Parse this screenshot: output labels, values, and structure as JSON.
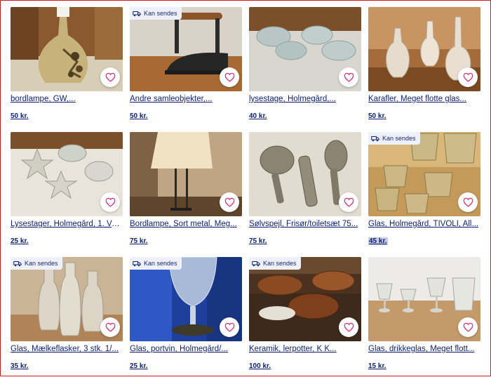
{
  "badge_label": "Kan sendes",
  "colors": {
    "link": "#0b1f7a",
    "heart": "#e0336b",
    "badge_bg": "#eef1fb"
  },
  "listings": [
    {
      "title": "bordlampe, GW,...",
      "price": "50 kr.",
      "ships": false,
      "image": "ceramic-lamp"
    },
    {
      "title": "Andre samleobjekter,...",
      "price": "50 kr.",
      "ships": true,
      "image": "flat-iron"
    },
    {
      "title": "lysestage, Holmegård,...",
      "price": "40 kr.",
      "ships": false,
      "image": "glass-candleholders"
    },
    {
      "title": "Karafler, Meget flotte glas...",
      "price": "50 kr.",
      "ships": false,
      "image": "glass-decanters"
    },
    {
      "title": "Lysestager, Holmegård, 1. Ve...",
      "price": "25 kr.",
      "ships": false,
      "image": "glass-stars"
    },
    {
      "title": "Bordlampe, Sort metal, Meg...",
      "price": "75 kr.",
      "ships": false,
      "image": "table-lamp"
    },
    {
      "title": "Sølvspejl, Frisør/toiletsæt 75...",
      "price": "75 kr.",
      "ships": false,
      "image": "silver-set"
    },
    {
      "title": "Glas, Holmegård, TIVOLI, All...",
      "price": "45 kr.",
      "ships": true,
      "image": "drinking-glasses",
      "price_highlighted": true
    },
    {
      "title": "Glas, Mælkeflasker, 3 stk. 1/...",
      "price": "35 kr.",
      "ships": true,
      "image": "milk-bottles"
    },
    {
      "title": "Glas, portvin, Holmegård/...",
      "price": "25 kr.",
      "ships": true,
      "image": "port-glass"
    },
    {
      "title": "Keramik, lerpotter, K K...",
      "price": "100 kr.",
      "ships": true,
      "image": "clay-pots"
    },
    {
      "title": "Glas, drikkeglas, Meget flott...",
      "price": "15 kr.",
      "ships": false,
      "image": "wine-glasses"
    }
  ]
}
